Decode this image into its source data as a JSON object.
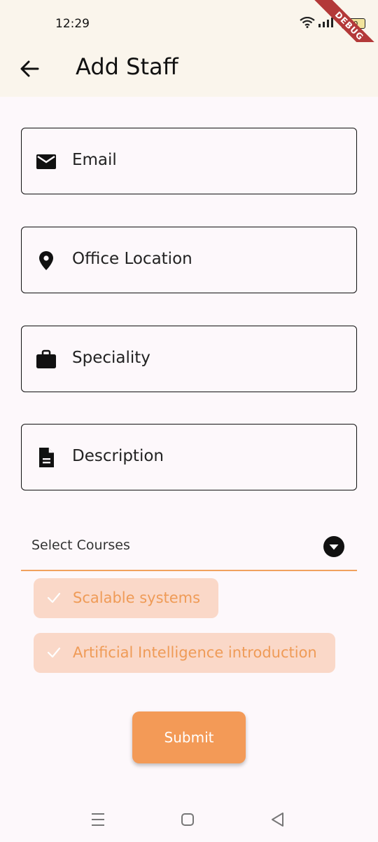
{
  "status_bar": {
    "time": "12:29",
    "battery": "60",
    "debug_label": "DEBUG"
  },
  "app_bar": {
    "title": "Add Staff",
    "back_icon": "arrow-back-icon"
  },
  "form": {
    "email": {
      "label": "Email",
      "icon": "mail-icon"
    },
    "office_location": {
      "label": "Office Location",
      "icon": "location-pin-icon"
    },
    "speciality": {
      "label": "Speciality",
      "icon": "briefcase-icon"
    },
    "description": {
      "label": "Description",
      "icon": "document-icon"
    },
    "courses": {
      "label": "Select Courses",
      "selected": [
        "Scalable systems",
        "Artificial Intelligence introduction"
      ]
    },
    "submit_label": "Submit"
  },
  "colors": {
    "accent": "#f39a57",
    "chip_background": "#fad8c8",
    "chip_text": "#ef9b57",
    "app_bar_background": "#faf5ec",
    "background": "#fdf8fb"
  }
}
